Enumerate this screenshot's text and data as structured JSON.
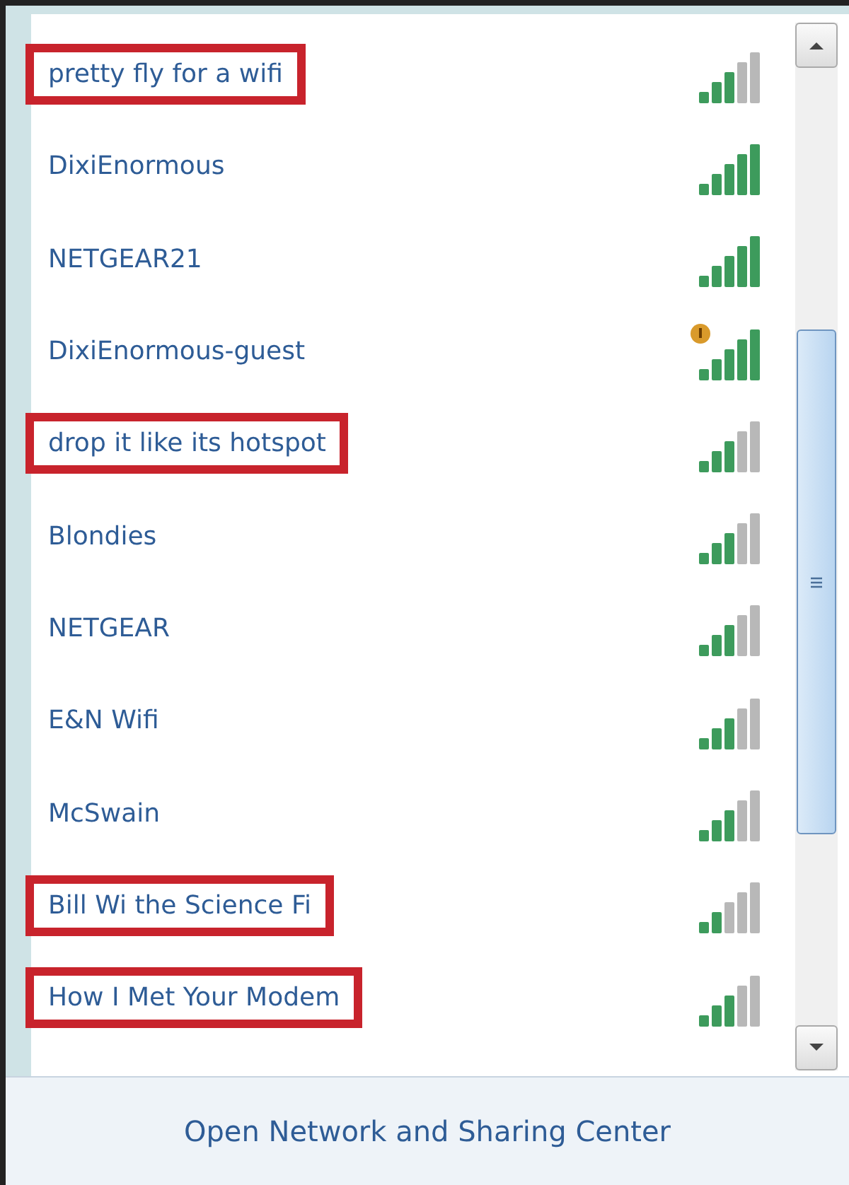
{
  "networks": [
    {
      "name": "pretty fly for a wifi",
      "kind": "medium",
      "warning": false,
      "highlighted": true
    },
    {
      "name": "DixiEnormous",
      "kind": "full",
      "warning": false,
      "highlighted": false
    },
    {
      "name": "NETGEAR21",
      "kind": "full",
      "warning": false,
      "highlighted": false
    },
    {
      "name": "DixiEnormous-guest",
      "kind": "full",
      "warning": true,
      "highlighted": false
    },
    {
      "name": "drop it like its hotspot",
      "kind": "medium",
      "warning": false,
      "highlighted": true
    },
    {
      "name": "Blondies",
      "kind": "medium",
      "warning": false,
      "highlighted": false
    },
    {
      "name": "NETGEAR",
      "kind": "medium",
      "warning": false,
      "highlighted": false
    },
    {
      "name": "E&N Wifi",
      "kind": "medium",
      "warning": false,
      "highlighted": false
    },
    {
      "name": "McSwain",
      "kind": "medium",
      "warning": false,
      "highlighted": false
    },
    {
      "name": "Bill Wi the Science Fi",
      "kind": "weak",
      "warning": false,
      "highlighted": true
    },
    {
      "name": "How I Met Your Modem",
      "kind": "medium",
      "warning": false,
      "highlighted": true
    }
  ],
  "footer_link": "Open Network and Sharing Center"
}
